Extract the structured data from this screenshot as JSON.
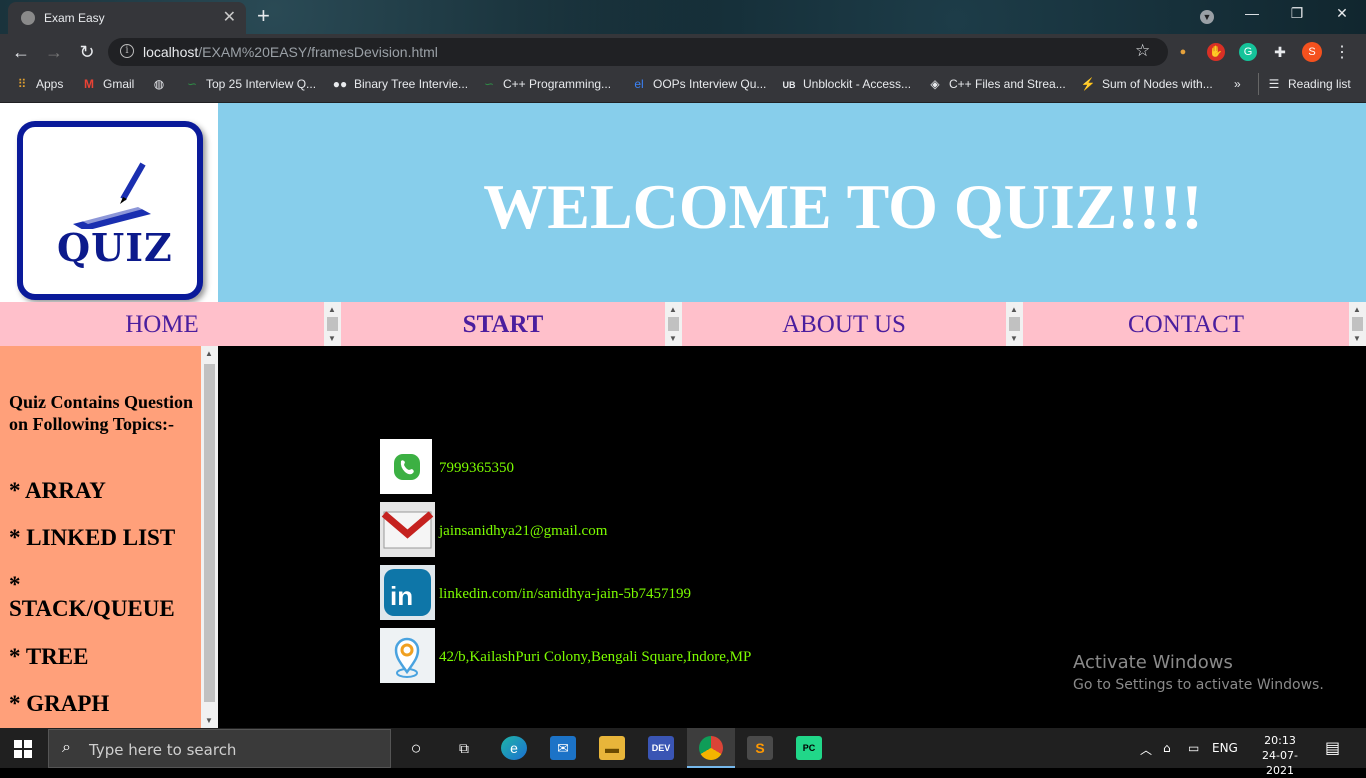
{
  "browser": {
    "tab_title": "Exam Easy",
    "url_host": "localhost",
    "url_path": "/EXAM%20EASY/framesDevision.html",
    "profile_initial": "S",
    "bookmarks": [
      {
        "label": "Apps",
        "icon": "apps-grid-icon"
      },
      {
        "label": "Gmail",
        "icon": "gmail-icon"
      },
      {
        "label": "",
        "icon": "globe-icon"
      },
      {
        "label": "Top 25 Interview Q...",
        "icon": "gfg-icon"
      },
      {
        "label": "Binary Tree Intervie...",
        "icon": "medium-icon"
      },
      {
        "label": "C++ Programming...",
        "icon": "gfg-icon"
      },
      {
        "label": "OOPs Interview Qu...",
        "icon": "el-icon"
      },
      {
        "label": "Unblockit - Access...",
        "icon": "ub-icon"
      },
      {
        "label": "C++ Files and Strea...",
        "icon": "tutorialspoint-icon"
      },
      {
        "label": "Sum of Nodes with...",
        "icon": "hackerrank-icon"
      }
    ],
    "overflow": "»",
    "reading_list": "Reading list"
  },
  "page": {
    "logo_text": "QUIZ",
    "welcome": "WELCOME TO QUIZ!!!!",
    "nav": [
      {
        "label": "HOME",
        "bold": false
      },
      {
        "label": "START",
        "bold": true
      },
      {
        "label": "ABOUT US",
        "bold": false
      },
      {
        "label": "CONTACT",
        "bold": false
      }
    ],
    "sidebar": {
      "intro": "Quiz Contains Question on Following Topics:-",
      "topics": [
        "* ARRAY",
        "* LINKED LIST",
        "* STACK/QUEUE",
        "* TREE",
        "* GRAPH"
      ]
    },
    "contacts": [
      {
        "icon": "phone-icon",
        "text": "7999365350"
      },
      {
        "icon": "gmail-icon",
        "text": "jainsanidhya21@gmail.com"
      },
      {
        "icon": "linkedin-icon",
        "text": "linkedin.com/in/sanidhya-jain-5b7457199"
      },
      {
        "icon": "location-pin-icon",
        "text": "42/b,KailashPuri Colony,Bengali Square,Indore,MP"
      }
    ]
  },
  "os": {
    "activate_title": "Activate Windows",
    "activate_sub": "Go to Settings to activate Windows.",
    "search_placeholder": "Type here to search",
    "lang": "ENG",
    "time": "20:13",
    "date": "24-07-2021"
  }
}
